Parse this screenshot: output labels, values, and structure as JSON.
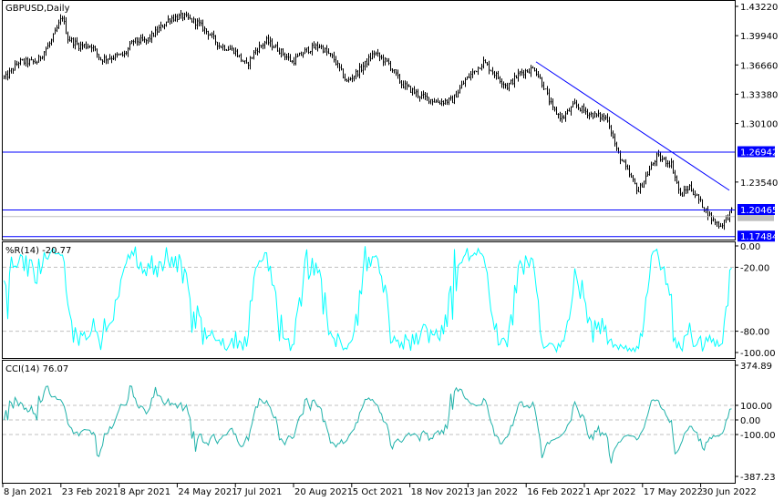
{
  "chart_data": {
    "type": "ohlc",
    "symbol_label": "GBPUSD,Daily",
    "price_axis": {
      "ticks": [
        "1.43220",
        "1.39940",
        "1.36660",
        "1.33380",
        "1.30100",
        "1.23540"
      ],
      "range": [
        1.1725,
        1.4322
      ]
    },
    "levels": [
      {
        "price": 1.26942,
        "label": "1.26942",
        "color": "#0000ff"
      },
      {
        "price": 1.20465,
        "label": "1.20465",
        "color": "#0000ff"
      },
      {
        "price": 1.17484,
        "label": "1.17484",
        "color": "#0000ff"
      }
    ],
    "bid_line": {
      "price": 1.1968,
      "color": "#c0c0c0"
    },
    "trendline": {
      "from": [
        292,
        1.3701
      ],
      "to": [
        398,
        1.2262
      ],
      "color": "#0000ff"
    },
    "close_path": [
      [
        1,
        1.3526
      ],
      [
        8,
        1.37
      ],
      [
        18,
        1.37
      ],
      [
        26,
        1.3934
      ],
      [
        32,
        1.421
      ],
      [
        35,
        1.3965
      ],
      [
        41,
        1.3883
      ],
      [
        48,
        1.3883
      ],
      [
        53,
        1.373
      ],
      [
        61,
        1.3761
      ],
      [
        66,
        1.3781
      ],
      [
        71,
        1.3934
      ],
      [
        78,
        1.3934
      ],
      [
        86,
        1.4087
      ],
      [
        91,
        1.4189
      ],
      [
        98,
        1.421
      ],
      [
        106,
        1.4138
      ],
      [
        113,
        1.4006
      ],
      [
        118,
        1.3883
      ],
      [
        126,
        1.3832
      ],
      [
        133,
        1.3659
      ],
      [
        138,
        1.3832
      ],
      [
        144,
        1.3934
      ],
      [
        151,
        1.3832
      ],
      [
        158,
        1.37
      ],
      [
        166,
        1.3832
      ],
      [
        173,
        1.3883
      ],
      [
        181,
        1.373
      ],
      [
        188,
        1.3475
      ],
      [
        196,
        1.3628
      ],
      [
        203,
        1.3802
      ],
      [
        211,
        1.3679
      ],
      [
        218,
        1.3455
      ],
      [
        228,
        1.3322
      ],
      [
        238,
        1.3251
      ],
      [
        246,
        1.3271
      ],
      [
        253,
        1.3495
      ],
      [
        263,
        1.37
      ],
      [
        271,
        1.3526
      ],
      [
        276,
        1.3424
      ],
      [
        283,
        1.3577
      ],
      [
        291,
        1.3628
      ],
      [
        296,
        1.3424
      ],
      [
        301,
        1.3169
      ],
      [
        306,
        1.3067
      ],
      [
        313,
        1.322
      ],
      [
        321,
        1.3118
      ],
      [
        331,
        1.3067
      ],
      [
        336,
        1.271
      ],
      [
        341,
        1.2506
      ],
      [
        348,
        1.2251
      ],
      [
        353,
        1.2455
      ],
      [
        358,
        1.2638
      ],
      [
        366,
        1.2557
      ],
      [
        371,
        1.22
      ],
      [
        376,
        1.2302
      ],
      [
        383,
        1.2098
      ],
      [
        388,
        1.1944
      ],
      [
        393,
        1.1863
      ],
      [
        399,
        1.2026
      ]
    ],
    "bar_count": 400,
    "x_ticks": [
      "8 Jan 2021",
      "23 Feb 2021",
      "8 Apr 2021",
      "24 May 2021",
      "7 Jul 2021",
      "20 Aug 2021",
      "5 Oct 2021",
      "18 Nov 2021",
      "3 Jan 2022",
      "16 Feb 2022",
      "1 Apr 2022",
      "17 May 2022",
      "30 Jun 2022"
    ],
    "indicators": [
      {
        "name": "wpr",
        "label": "%R(14) -20.77",
        "period": 14,
        "color": "#00ffff",
        "ticks": [
          "0.00",
          "-20.00",
          "-80.00",
          "-100.00"
        ],
        "levels": [
          -20,
          -80
        ],
        "range": [
          -100,
          0
        ]
      },
      {
        "name": "cci",
        "label": "CCI(14) 76.07",
        "period": 14,
        "color": "#20b2aa",
        "ticks": [
          "374.89",
          "100.00",
          "0.00",
          "-100.00",
          "-387.23"
        ],
        "levels": [
          100,
          0,
          -100
        ],
        "range": [
          -387.23,
          374.89
        ]
      }
    ]
  }
}
